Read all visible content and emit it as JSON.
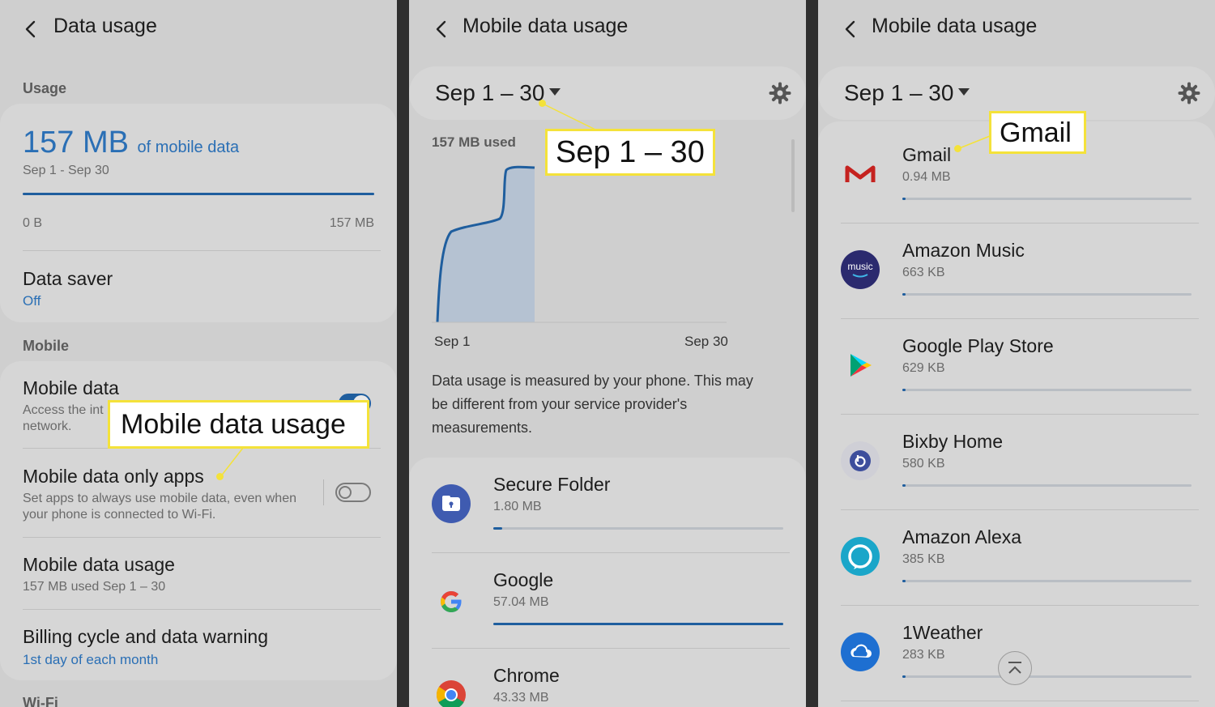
{
  "panel1": {
    "title": "Data usage",
    "usage_label": "Usage",
    "usage_amount": "157 MB",
    "usage_of": "of mobile data",
    "usage_range": "Sep 1 - Sep 30",
    "usage_fraction": 1.0,
    "bar_min": "0 B",
    "bar_max": "157 MB",
    "data_saver_title": "Data saver",
    "data_saver_status": "Off",
    "mobile_label": "Mobile",
    "mobile_data_title": "Mobile data",
    "mobile_data_sub_1": "Access the int",
    "mobile_data_sub_2": "network.",
    "mobile_data_on": true,
    "only_apps_title": "Mobile data only apps",
    "only_apps_sub": "Set apps to always use mobile data, even when your phone is connected to Wi-Fi.",
    "only_apps_on": false,
    "mdu_title": "Mobile data usage",
    "mdu_sub": "157 MB used Sep 1 – 30",
    "billing_title": "Billing cycle and data warning",
    "billing_sub": "1st day of each month",
    "wifi_label": "Wi-Fi",
    "callout": "Mobile data usage"
  },
  "panel2": {
    "title": "Mobile data usage",
    "cycle": "Sep 1 – 30",
    "used_label": "157 MB used",
    "x_start": "Sep 1",
    "x_end": "Sep 30",
    "note": "Data usage is measured by your phone. This may be different from your service provider's measurements.",
    "callout": "Sep 1 – 30",
    "apps": [
      {
        "name": "Secure Folder",
        "size": "1.80 MB",
        "fraction": 0.03
      },
      {
        "name": "Google",
        "size": "57.04 MB",
        "fraction": 1.0
      },
      {
        "name": "Chrome",
        "size": "43.33 MB",
        "fraction": 0.76
      }
    ]
  },
  "panel3": {
    "title": "Mobile data usage",
    "cycle": "Sep 1 – 30",
    "callout": "Gmail",
    "apps": [
      {
        "name": "Gmail",
        "size": "0.94 MB",
        "fraction": 0.01
      },
      {
        "name": "Amazon Music",
        "size": "663 KB",
        "fraction": 0.0,
        "icon_text": "music"
      },
      {
        "name": "Google Play Store",
        "size": "629 KB",
        "fraction": 0.0
      },
      {
        "name": "Bixby Home",
        "size": "580 KB",
        "fraction": 0.0
      },
      {
        "name": "Amazon Alexa",
        "size": "385 KB",
        "fraction": 0.0
      },
      {
        "name": "1Weather",
        "size": "283 KB",
        "fraction": 0.0
      }
    ]
  },
  "colors": {
    "accent": "#2a6fb5",
    "bar": "#1f5e9e",
    "callout_border": "#f4e23a",
    "background": "#cfcfcf"
  }
}
